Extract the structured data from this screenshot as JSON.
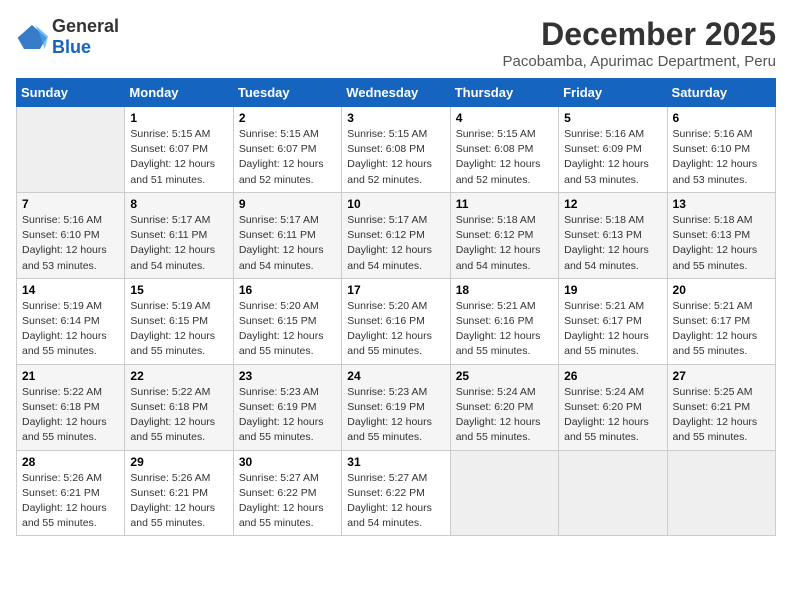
{
  "header": {
    "logo_general": "General",
    "logo_blue": "Blue",
    "title": "December 2025",
    "subtitle": "Pacobamba, Apurimac Department, Peru"
  },
  "calendar": {
    "days_of_week": [
      "Sunday",
      "Monday",
      "Tuesday",
      "Wednesday",
      "Thursday",
      "Friday",
      "Saturday"
    ],
    "weeks": [
      [
        {
          "day": "",
          "sunrise": "",
          "sunset": "",
          "daylight": ""
        },
        {
          "day": "1",
          "sunrise": "Sunrise: 5:15 AM",
          "sunset": "Sunset: 6:07 PM",
          "daylight": "Daylight: 12 hours and 51 minutes."
        },
        {
          "day": "2",
          "sunrise": "Sunrise: 5:15 AM",
          "sunset": "Sunset: 6:07 PM",
          "daylight": "Daylight: 12 hours and 52 minutes."
        },
        {
          "day": "3",
          "sunrise": "Sunrise: 5:15 AM",
          "sunset": "Sunset: 6:08 PM",
          "daylight": "Daylight: 12 hours and 52 minutes."
        },
        {
          "day": "4",
          "sunrise": "Sunrise: 5:15 AM",
          "sunset": "Sunset: 6:08 PM",
          "daylight": "Daylight: 12 hours and 52 minutes."
        },
        {
          "day": "5",
          "sunrise": "Sunrise: 5:16 AM",
          "sunset": "Sunset: 6:09 PM",
          "daylight": "Daylight: 12 hours and 53 minutes."
        },
        {
          "day": "6",
          "sunrise": "Sunrise: 5:16 AM",
          "sunset": "Sunset: 6:10 PM",
          "daylight": "Daylight: 12 hours and 53 minutes."
        }
      ],
      [
        {
          "day": "7",
          "sunrise": "Sunrise: 5:16 AM",
          "sunset": "Sunset: 6:10 PM",
          "daylight": "Daylight: 12 hours and 53 minutes."
        },
        {
          "day": "8",
          "sunrise": "Sunrise: 5:17 AM",
          "sunset": "Sunset: 6:11 PM",
          "daylight": "Daylight: 12 hours and 54 minutes."
        },
        {
          "day": "9",
          "sunrise": "Sunrise: 5:17 AM",
          "sunset": "Sunset: 6:11 PM",
          "daylight": "Daylight: 12 hours and 54 minutes."
        },
        {
          "day": "10",
          "sunrise": "Sunrise: 5:17 AM",
          "sunset": "Sunset: 6:12 PM",
          "daylight": "Daylight: 12 hours and 54 minutes."
        },
        {
          "day": "11",
          "sunrise": "Sunrise: 5:18 AM",
          "sunset": "Sunset: 6:12 PM",
          "daylight": "Daylight: 12 hours and 54 minutes."
        },
        {
          "day": "12",
          "sunrise": "Sunrise: 5:18 AM",
          "sunset": "Sunset: 6:13 PM",
          "daylight": "Daylight: 12 hours and 54 minutes."
        },
        {
          "day": "13",
          "sunrise": "Sunrise: 5:18 AM",
          "sunset": "Sunset: 6:13 PM",
          "daylight": "Daylight: 12 hours and 55 minutes."
        }
      ],
      [
        {
          "day": "14",
          "sunrise": "Sunrise: 5:19 AM",
          "sunset": "Sunset: 6:14 PM",
          "daylight": "Daylight: 12 hours and 55 minutes."
        },
        {
          "day": "15",
          "sunrise": "Sunrise: 5:19 AM",
          "sunset": "Sunset: 6:15 PM",
          "daylight": "Daylight: 12 hours and 55 minutes."
        },
        {
          "day": "16",
          "sunrise": "Sunrise: 5:20 AM",
          "sunset": "Sunset: 6:15 PM",
          "daylight": "Daylight: 12 hours and 55 minutes."
        },
        {
          "day": "17",
          "sunrise": "Sunrise: 5:20 AM",
          "sunset": "Sunset: 6:16 PM",
          "daylight": "Daylight: 12 hours and 55 minutes."
        },
        {
          "day": "18",
          "sunrise": "Sunrise: 5:21 AM",
          "sunset": "Sunset: 6:16 PM",
          "daylight": "Daylight: 12 hours and 55 minutes."
        },
        {
          "day": "19",
          "sunrise": "Sunrise: 5:21 AM",
          "sunset": "Sunset: 6:17 PM",
          "daylight": "Daylight: 12 hours and 55 minutes."
        },
        {
          "day": "20",
          "sunrise": "Sunrise: 5:21 AM",
          "sunset": "Sunset: 6:17 PM",
          "daylight": "Daylight: 12 hours and 55 minutes."
        }
      ],
      [
        {
          "day": "21",
          "sunrise": "Sunrise: 5:22 AM",
          "sunset": "Sunset: 6:18 PM",
          "daylight": "Daylight: 12 hours and 55 minutes."
        },
        {
          "day": "22",
          "sunrise": "Sunrise: 5:22 AM",
          "sunset": "Sunset: 6:18 PM",
          "daylight": "Daylight: 12 hours and 55 minutes."
        },
        {
          "day": "23",
          "sunrise": "Sunrise: 5:23 AM",
          "sunset": "Sunset: 6:19 PM",
          "daylight": "Daylight: 12 hours and 55 minutes."
        },
        {
          "day": "24",
          "sunrise": "Sunrise: 5:23 AM",
          "sunset": "Sunset: 6:19 PM",
          "daylight": "Daylight: 12 hours and 55 minutes."
        },
        {
          "day": "25",
          "sunrise": "Sunrise: 5:24 AM",
          "sunset": "Sunset: 6:20 PM",
          "daylight": "Daylight: 12 hours and 55 minutes."
        },
        {
          "day": "26",
          "sunrise": "Sunrise: 5:24 AM",
          "sunset": "Sunset: 6:20 PM",
          "daylight": "Daylight: 12 hours and 55 minutes."
        },
        {
          "day": "27",
          "sunrise": "Sunrise: 5:25 AM",
          "sunset": "Sunset: 6:21 PM",
          "daylight": "Daylight: 12 hours and 55 minutes."
        }
      ],
      [
        {
          "day": "28",
          "sunrise": "Sunrise: 5:26 AM",
          "sunset": "Sunset: 6:21 PM",
          "daylight": "Daylight: 12 hours and 55 minutes."
        },
        {
          "day": "29",
          "sunrise": "Sunrise: 5:26 AM",
          "sunset": "Sunset: 6:21 PM",
          "daylight": "Daylight: 12 hours and 55 minutes."
        },
        {
          "day": "30",
          "sunrise": "Sunrise: 5:27 AM",
          "sunset": "Sunset: 6:22 PM",
          "daylight": "Daylight: 12 hours and 55 minutes."
        },
        {
          "day": "31",
          "sunrise": "Sunrise: 5:27 AM",
          "sunset": "Sunset: 6:22 PM",
          "daylight": "Daylight: 12 hours and 54 minutes."
        },
        {
          "day": "",
          "sunrise": "",
          "sunset": "",
          "daylight": ""
        },
        {
          "day": "",
          "sunrise": "",
          "sunset": "",
          "daylight": ""
        },
        {
          "day": "",
          "sunrise": "",
          "sunset": "",
          "daylight": ""
        }
      ]
    ]
  }
}
